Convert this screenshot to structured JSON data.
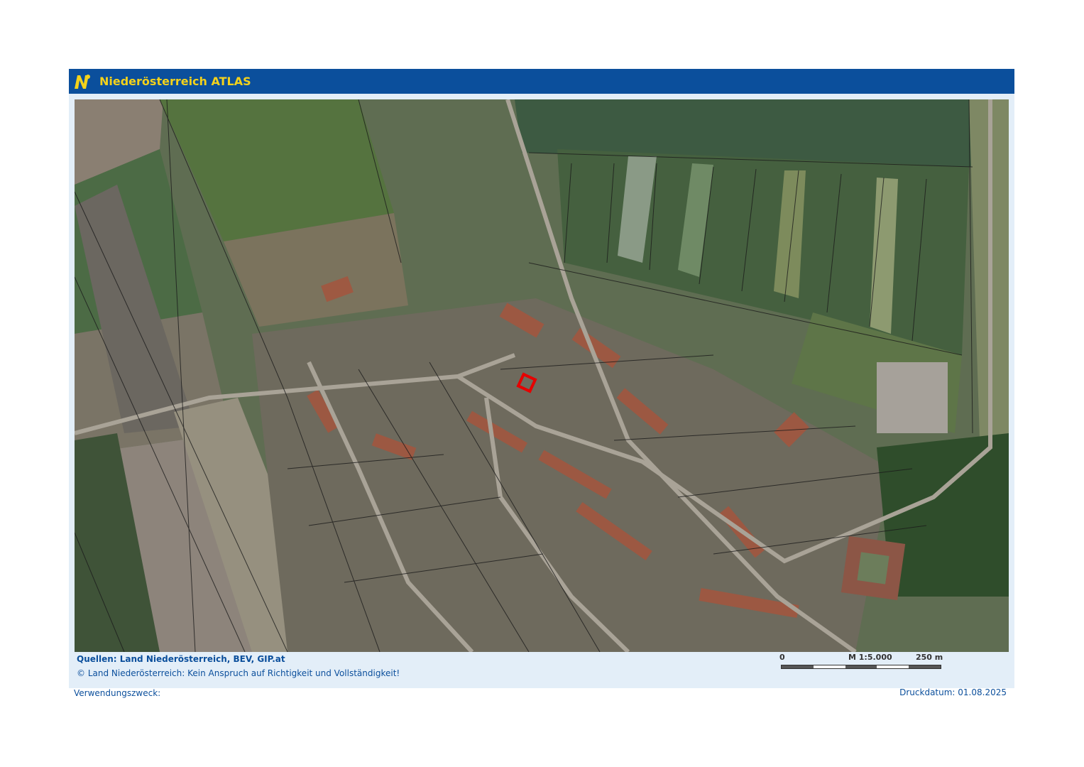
{
  "header": {
    "title": "Niederösterreich ATLAS",
    "logo_icon": "noe-logo-icon",
    "bar_color": "#0b4f9c",
    "title_color": "#f4d21b"
  },
  "map": {
    "type": "aerial cadastral map",
    "marker_color": "#e60000"
  },
  "sources": "Quellen: Land Niederösterreich, BEV, GIP.at",
  "copyright": "© Land Niederösterreich: Kein Anspruch auf Richtigkeit und Vollständigkeit!",
  "scale": {
    "start_label": "0",
    "ratio_label": "M 1:5.000",
    "end_label": "250 m"
  },
  "footer": {
    "purpose_label": "Verwendungszweck:",
    "print_date": "Druckdatum: 01.08.2025"
  }
}
